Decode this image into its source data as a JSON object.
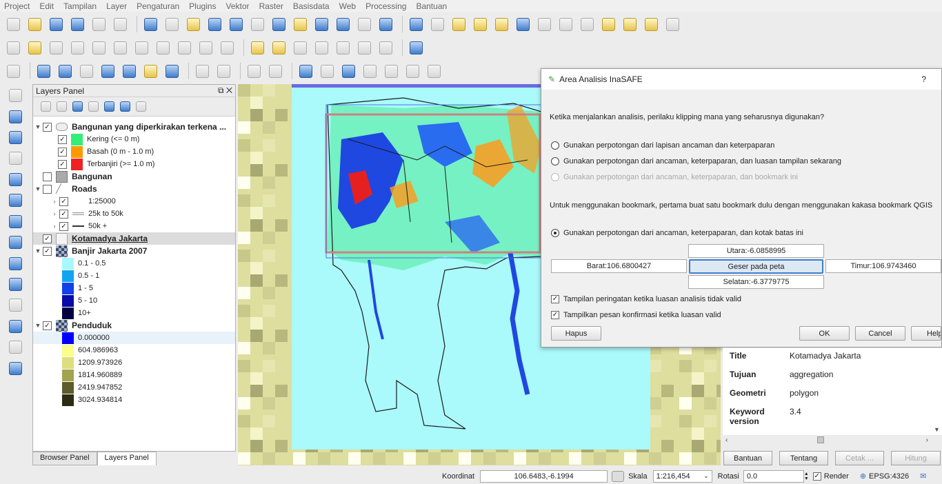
{
  "menu": [
    "Project",
    "Edit",
    "Tampilan",
    "Layer",
    "Pengaturan",
    "Plugins",
    "Vektor",
    "Raster",
    "Basisdata",
    "Web",
    "Processing",
    "Bantuan"
  ],
  "layers_panel": {
    "title": "Layers Panel",
    "controls": "⧉ ✕",
    "layers": [
      {
        "name": "Bangunan yang diperkirakan terkena ...",
        "legend": [
          {
            "label": "Kering  (<= 0 m)",
            "color": "#33ee77"
          },
          {
            "label": "Basah  (0 m - 1.0 m)",
            "color": "#ff9900"
          },
          {
            "label": "Terbanjiri  (>= 1.0 m)",
            "color": "#ee2222"
          }
        ]
      },
      {
        "name": "Bangunan"
      },
      {
        "name": "Roads",
        "legend": [
          "1:25000",
          "25k to 50k",
          "50k +"
        ]
      },
      {
        "name": "Kotamadya Jakarta"
      },
      {
        "name": "Banjir Jakarta 2007",
        "legend": [
          {
            "label": "0.1 - 0.5",
            "color": "#a8f8ff"
          },
          {
            "label": "0.5 - 1",
            "color": "#12a4f0"
          },
          {
            "label": "1 - 5",
            "color": "#1040e8"
          },
          {
            "label": "5 - 10",
            "color": "#0a0aa8"
          },
          {
            "label": "10+",
            "color": "#020240"
          }
        ]
      },
      {
        "name": "Penduduk",
        "legend": [
          {
            "label": "0.000000",
            "color": "#0000ff"
          },
          {
            "label": "604.986963",
            "color": "#fdfd8a"
          },
          {
            "label": "1209.973926",
            "color": "#dede7e"
          },
          {
            "label": "1814.960889",
            "color": "#a3a350"
          },
          {
            "label": "2419.947852",
            "color": "#5c5c2c"
          },
          {
            "label": "3024.934814",
            "color": "#2c2c14"
          }
        ]
      }
    ],
    "tabs": [
      "Browser Panel",
      "Layers Panel"
    ]
  },
  "dialog": {
    "title": "Area Analisis InaSAFE",
    "help_mark": "?",
    "question": "Ketika menjalankan analisis, perilaku klipping mana yang seharusnya digunakan?",
    "options": [
      "Gunakan perpotongan dari lapisan ancaman dan keterpaparan",
      "Gunakan perpotongan dari ancaman, keterpaparan, dan luasan tampilan sekarang",
      "Gunakan perpotongan dari ancaman, keterpaparan, dan bookmark ini"
    ],
    "bookmark_note": "Untuk menggunakan bookmark, pertama buat satu bookmark dulu dengan menggunakan kakasa bookmark QGIS",
    "bbox_option": "Gunakan perpotongan dari ancaman, keterpaparan, dan kotak batas ini",
    "north": "Utara:-6.0858995",
    "west": "Barat:106.6800427",
    "east": "Timur:106.9743460",
    "south": "Selatan:-6.3779775",
    "pan_button": "Geser pada peta",
    "check1": "Tampilan peringatan ketika luasan analisis tidak valid",
    "check2": "Tampilkan pesan konfirmasi ketika luasan valid",
    "clear_button": "Hapus",
    "ok_button": "OK",
    "cancel_button": "Cancel",
    "help_button": "Help"
  },
  "info": {
    "rows": [
      {
        "key": "Title",
        "value": "Kotamadya Jakarta"
      },
      {
        "key": "Tujuan",
        "value": "aggregation"
      },
      {
        "key": "Geometri",
        "value": "polygon"
      },
      {
        "key": "Keyword version",
        "value": "3.4"
      }
    ],
    "buttons": [
      "Bantuan",
      "Tentang",
      "Cetak ...",
      "Hitung"
    ]
  },
  "status": {
    "coord_label": "Koordinat",
    "coord_value": "106.6483,-6.1994",
    "scale_label": "Skala",
    "scale_value": "1:216,454",
    "rotation_label": "Rotasi",
    "rotation_value": "0.0",
    "render_label": "Render",
    "crs": "EPSG:4326"
  }
}
